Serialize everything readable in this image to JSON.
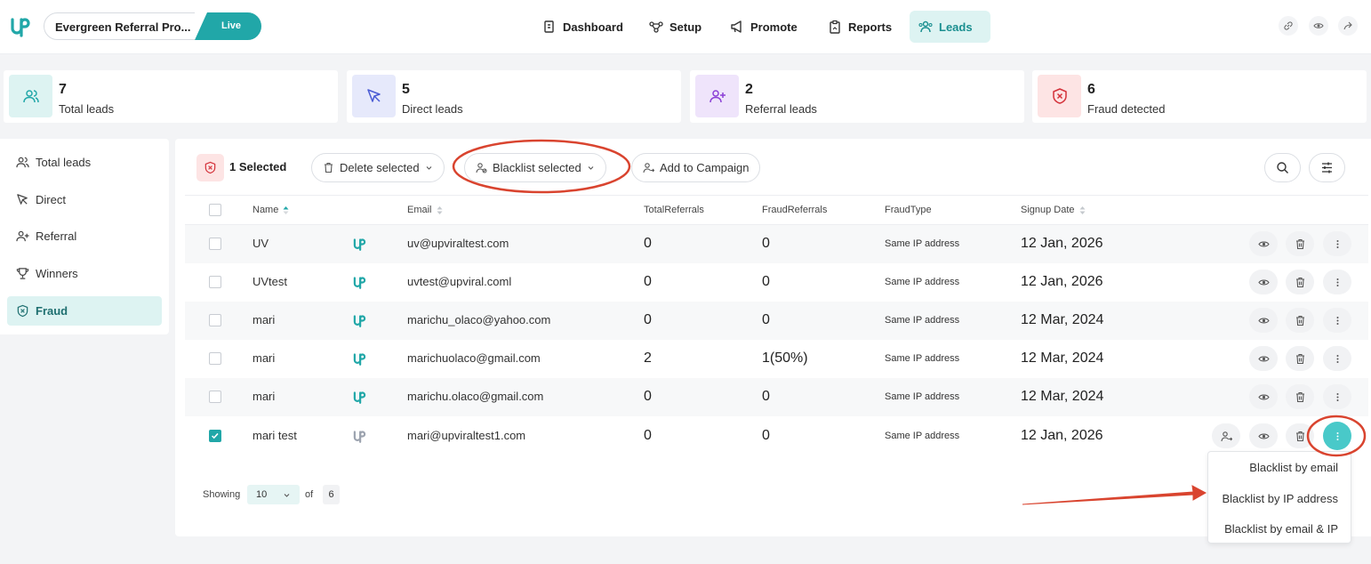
{
  "header": {
    "campaign_name": "Evergreen Referral Pro...",
    "status": "Live",
    "nav": [
      {
        "label": "Dashboard",
        "icon": "dashboard-icon"
      },
      {
        "label": "Setup",
        "icon": "setup-icon"
      },
      {
        "label": "Promote",
        "icon": "megaphone-icon"
      },
      {
        "label": "Reports",
        "icon": "clipboard-icon"
      },
      {
        "label": "Leads",
        "icon": "users-icon",
        "active": true
      }
    ],
    "tools": [
      "link-icon",
      "eye-icon",
      "share-icon"
    ]
  },
  "stats": [
    {
      "value": "7",
      "label": "Total leads",
      "color": "#ddf3f2"
    },
    {
      "value": "5",
      "label": "Direct leads",
      "color": "#e6e9fb"
    },
    {
      "value": "2",
      "label": "Referral leads",
      "color": "#efe4fb"
    },
    {
      "value": "6",
      "label": "Fraud detected",
      "color": "#fde4e4"
    }
  ],
  "sidebar": {
    "items": [
      {
        "label": "Total leads"
      },
      {
        "label": "Direct"
      },
      {
        "label": "Referral"
      },
      {
        "label": "Winners"
      },
      {
        "label": "Fraud",
        "active": true
      }
    ]
  },
  "toolbar": {
    "selected_text": "1 Selected",
    "delete_label": "Delete selected",
    "blacklist_label": "Blacklist selected",
    "add_campaign_label": "Add to Campaign"
  },
  "table": {
    "columns": [
      "Name",
      "Email",
      "TotalReferrals",
      "FraudReferrals",
      "FraudType",
      "Signup Date"
    ],
    "rows": [
      {
        "name": "UV",
        "email": "uv@upviraltest.com",
        "total": "0",
        "fraud": "0",
        "type": "Same IP address",
        "date": "12 Jan, 2026",
        "checked": false
      },
      {
        "name": "UVtest",
        "email": "uvtest@upviral.coml",
        "total": "0",
        "fraud": "0",
        "type": "Same IP address",
        "date": "12 Jan, 2026",
        "checked": false
      },
      {
        "name": "mari",
        "email": "marichu_olaco@yahoo.com",
        "total": "0",
        "fraud": "0",
        "type": "Same IP address",
        "date": "12 Mar, 2024",
        "checked": false
      },
      {
        "name": "mari",
        "email": "marichuolaco@gmail.com",
        "total": "2",
        "fraud": "1(50%)",
        "type": "Same IP address",
        "date": "12 Mar, 2024",
        "checked": false
      },
      {
        "name": "mari",
        "email": "marichu.olaco@gmail.com",
        "total": "0",
        "fraud": "0",
        "type": "Same IP address",
        "date": "12 Mar, 2024",
        "checked": false
      },
      {
        "name": "mari test",
        "email": "mari@upviraltest1.com",
        "total": "0",
        "fraud": "0",
        "type": "Same IP address",
        "date": "12 Jan, 2026",
        "checked": true
      }
    ]
  },
  "pagination": {
    "showing_label": "Showing",
    "per_page": "10",
    "of_label": "of",
    "total": "6"
  },
  "dropdown": {
    "items": [
      "Blacklist by email",
      "Blacklist by IP address",
      "Blacklist by email & IP"
    ]
  },
  "colors": {
    "accent": "#21a7a8",
    "annotation": "#d9442f"
  }
}
